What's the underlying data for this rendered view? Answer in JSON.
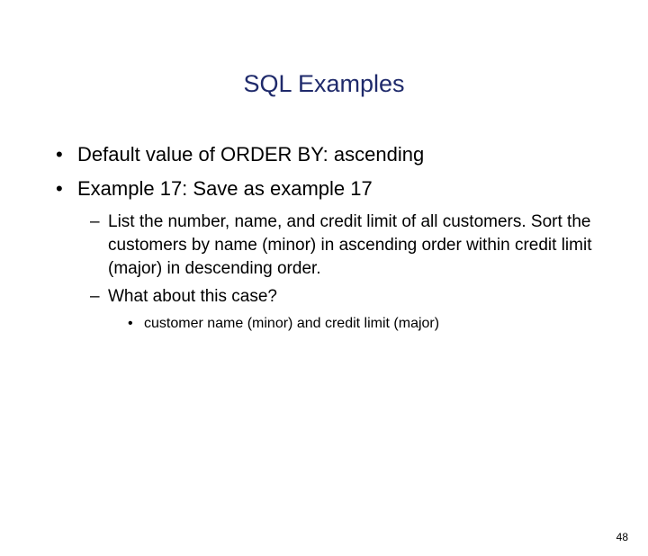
{
  "title": "SQL Examples",
  "bullets": {
    "b1": "Default value of ORDER BY: ascending",
    "b2": "Example 17: Save as example 17",
    "b2_sub": {
      "s1": "List the number, name, and credit limit of all customers. Sort the customers by name (minor) in ascending order within credit limit (major) in descending order.",
      "s2": "What about this case?",
      "s2_sub": {
        "t1": "customer name (minor) and credit limit (major)"
      }
    }
  },
  "page_number": "48"
}
